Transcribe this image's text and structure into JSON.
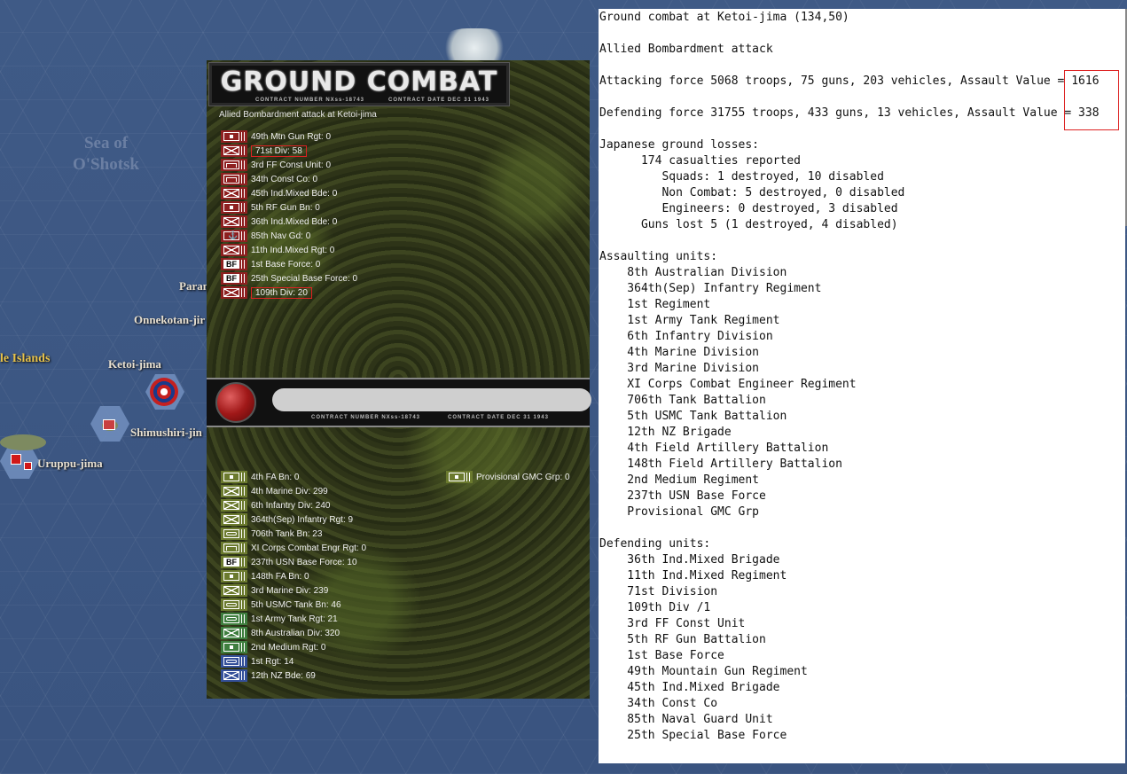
{
  "map": {
    "sea_label": "Sea of\nO'Shotsk",
    "labels": {
      "kuril": "le Islands",
      "onnekotan": "Onnekotan-jir",
      "ketoi": "Ketoi-jima",
      "shimushiri": "Shimushiri-jin",
      "uruppu": "Uruppu-jima",
      "param": "Param"
    }
  },
  "combat": {
    "title": "GROUND COMBAT",
    "contract_left": "CONTRACT NUMBER NXss-18743",
    "contract_right": "CONTRACT DATE DEC 31 1943",
    "subtitle": "Allied Bombardment attack at Ketoi-jima",
    "defenders": [
      {
        "label": "49th Mtn Gun Rgt: 0",
        "icon": "artillery-icon"
      },
      {
        "label": "71st Div: 58",
        "icon": "infantry-icon"
      },
      {
        "label": "3rd FF Const Unit: 0",
        "icon": "engineer-icon"
      },
      {
        "label": "34th Const Co: 0",
        "icon": "engineer-icon"
      },
      {
        "label": "45th Ind.Mixed Bde: 0",
        "icon": "infantry-icon"
      },
      {
        "label": "5th RF Gun Bn: 0",
        "icon": "artillery-icon"
      },
      {
        "label": "36th Ind.Mixed Bde: 0",
        "icon": "infantry-icon"
      },
      {
        "label": "85th Nav Gd: 0",
        "icon": "naval-guard-icon"
      },
      {
        "label": "11th Ind.Mixed Rgt: 0",
        "icon": "infantry-icon"
      },
      {
        "label": "1st Base Force: 0",
        "icon": "base-force-icon"
      },
      {
        "label": "25th Special Base Force: 0",
        "icon": "base-force-icon"
      },
      {
        "label": "109th Div: 20",
        "icon": "infantry-icon"
      }
    ],
    "attackers": [
      {
        "label": "4th FA Bn: 0",
        "icon": "artillery-icon"
      },
      {
        "label": "4th Marine Div: 299",
        "icon": "infantry-icon"
      },
      {
        "label": "6th Infantry Div: 240",
        "icon": "infantry-icon"
      },
      {
        "label": "364th(Sep) Infantry Rgt: 9",
        "icon": "infantry-icon"
      },
      {
        "label": "706th Tank Bn: 23",
        "icon": "tank-icon"
      },
      {
        "label": "XI Corps Combat Engr Rgt: 0",
        "icon": "engineer-icon"
      },
      {
        "label": "237th USN Base Force: 10",
        "icon": "base-force-icon"
      },
      {
        "label": "148th FA Bn: 0",
        "icon": "artillery-icon"
      },
      {
        "label": "3rd Marine Div: 239",
        "icon": "infantry-icon"
      },
      {
        "label": "5th USMC Tank Bn: 46",
        "icon": "tank-icon"
      },
      {
        "label": "1st Army Tank Rgt: 21",
        "icon": "tank-icon"
      },
      {
        "label": "8th Australian Div: 320",
        "icon": "infantry-icon"
      },
      {
        "label": "2nd Medium Rgt: 0",
        "icon": "artillery-icon"
      },
      {
        "label": "1st Rgt: 14",
        "icon": "tank-icon"
      },
      {
        "label": "12th NZ Bde: 69",
        "icon": "infantry-icon"
      }
    ],
    "extra_attacker": {
      "label": "Provisional GMC Grp: 0",
      "icon": "artillery-icon"
    }
  },
  "report": {
    "lines": [
      "Ground combat at Ketoi-jima (134,50)",
      "",
      "Allied Bombardment attack",
      "",
      "Attacking force 5068 troops, 75 guns, 203 vehicles, Assault Value = 1616",
      "",
      "Defending force 31755 troops, 433 guns, 13 vehicles, Assault Value = 338",
      "",
      "Japanese ground losses:",
      "      174 casualties reported",
      "         Squads: 1 destroyed, 10 disabled",
      "         Non Combat: 5 destroyed, 0 disabled",
      "         Engineers: 0 destroyed, 3 disabled",
      "      Guns lost 5 (1 destroyed, 4 disabled)",
      "",
      "Assaulting units:",
      "    8th Australian Division",
      "    364th(Sep) Infantry Regiment",
      "    1st Regiment",
      "    1st Army Tank Regiment",
      "    6th Infantry Division",
      "    4th Marine Division",
      "    3rd Marine Division",
      "    XI Corps Combat Engineer Regiment",
      "    706th Tank Battalion",
      "    5th USMC Tank Battalion",
      "    12th NZ Brigade",
      "    4th Field Artillery Battalion",
      "    148th Field Artillery Battalion",
      "    2nd Medium Regiment",
      "    237th USN Base Force",
      "    Provisional GMC Grp",
      "",
      "Defending units:",
      "    36th Ind.Mixed Brigade",
      "    11th Ind.Mixed Regiment",
      "    71st Division",
      "    109th Div /1",
      "    3rd FF Const Unit",
      "    5th RF Gun Battalion",
      "    1st Base Force",
      "    49th Mountain Gun Regiment",
      "    45th Ind.Mixed Brigade",
      "    34th Const Co",
      "    85th Naval Guard Unit",
      "    25th Special Base Force"
    ]
  }
}
